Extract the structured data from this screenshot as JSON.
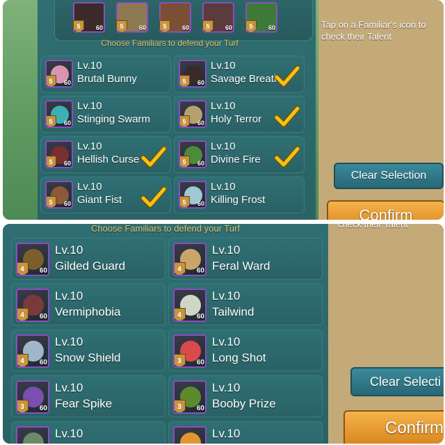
{
  "screenshot1": {
    "header": "Choose Familiars to defend your Turf",
    "side_hint": "Tap on a Familiar's icon to check their Talent",
    "clear_button": "Clear Selection",
    "confirm_button": "Confirm",
    "top_slots": [
      {
        "badge": "5",
        "level": "60",
        "color": "#3b2a2a"
      },
      {
        "badge": "5",
        "level": "60",
        "color": "#8e7a52"
      },
      {
        "badge": "5",
        "level": "60",
        "color": "#7a4f34"
      },
      {
        "badge": "5",
        "level": "60",
        "color": "#5b3b3b"
      },
      {
        "badge": "5",
        "level": "60",
        "color": "#3d7a3a"
      }
    ],
    "familiars": [
      {
        "level": "Lv.10",
        "name": "Brutal Bunny",
        "badge": "5",
        "stat": "60",
        "color": "#d995b0",
        "checked": false
      },
      {
        "level": "Lv.10",
        "name": "Savage Breath",
        "badge": "5",
        "stat": "60",
        "color": "#3b2a2a",
        "checked": true
      },
      {
        "level": "Lv.10",
        "name": "Stinging Swarm",
        "badge": "5",
        "stat": "60",
        "color": "#3cb0b5",
        "checked": false
      },
      {
        "level": "Lv.10",
        "name": "Holy Terror",
        "badge": "5",
        "stat": "60",
        "color": "#b7a070",
        "checked": true
      },
      {
        "level": "Lv.10",
        "name": "Hellish Curse",
        "badge": "5",
        "stat": "60",
        "color": "#7a2f2f",
        "checked": true
      },
      {
        "level": "Lv.10",
        "name": "Divine Fire",
        "badge": "5",
        "stat": "60",
        "color": "#4d8a3a",
        "checked": true
      },
      {
        "level": "Lv.10",
        "name": "Giant Fist",
        "badge": "5",
        "stat": "60",
        "color": "#8a5a3a",
        "checked": true
      },
      {
        "level": "Lv.10",
        "name": "Killing Frost",
        "badge": "5",
        "stat": "60",
        "color": "#9fc7d6",
        "checked": false
      }
    ]
  },
  "screenshot2": {
    "header": "Choose Familiars to defend your Turf",
    "side_hint": "check their Talent",
    "clear_button": "Clear Selecti",
    "confirm_button": "Confirm",
    "familiars": [
      {
        "level": "Lv.10",
        "name": "Gilded Guard",
        "badge": "4",
        "stat": "60",
        "color": "#7a5f2a"
      },
      {
        "level": "Lv.10",
        "name": "Feral Ward",
        "badge": "4",
        "stat": "60",
        "color": "#c9a56a"
      },
      {
        "level": "Lv.10",
        "name": "Vermiphobia",
        "badge": "4",
        "stat": "60",
        "color": "#7b3a3a"
      },
      {
        "level": "Lv.10",
        "name": "Tailwind",
        "badge": "4",
        "stat": "60",
        "color": "#cfd6c6"
      },
      {
        "level": "Lv.10",
        "name": "Snow Shield",
        "badge": "4",
        "stat": "60",
        "color": "#9fb7c9"
      },
      {
        "level": "Lv.10",
        "name": "Long Shot",
        "badge": "3",
        "stat": "60",
        "color": "#d94b4b"
      },
      {
        "level": "Lv.10",
        "name": "Fear Spike",
        "badge": "3",
        "stat": "60",
        "color": "#7a4fb0"
      },
      {
        "level": "Lv.10",
        "name": "Booby Prize",
        "badge": "3",
        "stat": "60",
        "color": "#5e8a2e"
      },
      {
        "level": "Lv.10",
        "name": "",
        "badge": "",
        "stat": "",
        "color": "#6a8a6a"
      },
      {
        "level": "Lv.10",
        "name": "",
        "badge": "",
        "stat": "",
        "color": "#e0962e"
      }
    ]
  }
}
